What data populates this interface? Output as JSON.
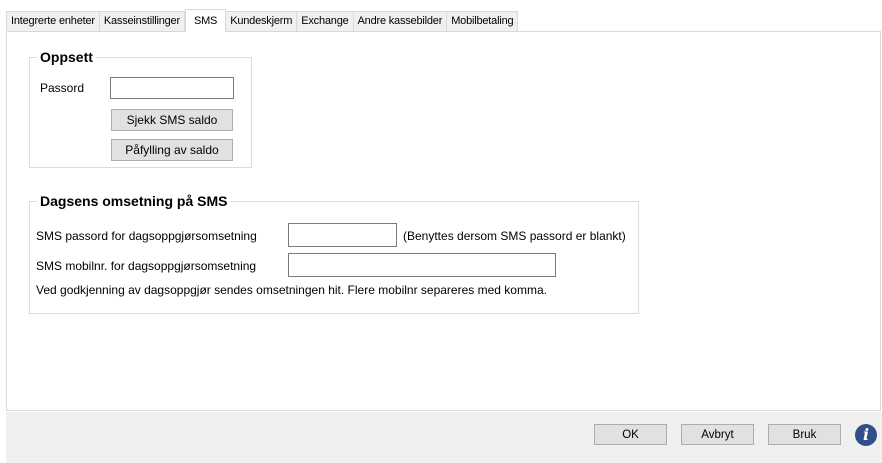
{
  "tabs": [
    {
      "label": "Integrerte enheter",
      "active": false
    },
    {
      "label": "Kasseinstillinger",
      "active": false
    },
    {
      "label": "SMS",
      "active": true
    },
    {
      "label": "Kundeskjerm",
      "active": false
    },
    {
      "label": "Exchange",
      "active": false
    },
    {
      "label": "Andre kassebilder",
      "active": false
    },
    {
      "label": "Mobilbetaling",
      "active": false
    }
  ],
  "setup": {
    "title": "Oppsett",
    "password_label": "Passord",
    "password_value": "",
    "check_balance_button": "Sjekk SMS saldo",
    "topup_button": "Påfylling av saldo"
  },
  "daily": {
    "title": "Dagsens omsetning på SMS",
    "password_label": "SMS passord for dagsoppgjørsomsetning",
    "password_value": "",
    "password_hint": "(Benyttes dersom SMS passord er blankt)",
    "mobile_label": "SMS mobilnr. for dagsoppgjørsomsetning",
    "mobile_value": "",
    "note": "Ved godkjenning av dagsoppgjør sendes omsetningen hit. Flere mobilnr separeres med komma."
  },
  "footer": {
    "ok_label": "OK",
    "cancel_label": "Avbryt",
    "apply_label": "Bruk",
    "info_glyph": "i"
  },
  "colors": {
    "info_icon": "#2f4f8a",
    "button_face": "#e1e1e1",
    "footer_background": "#f0f0f0"
  }
}
